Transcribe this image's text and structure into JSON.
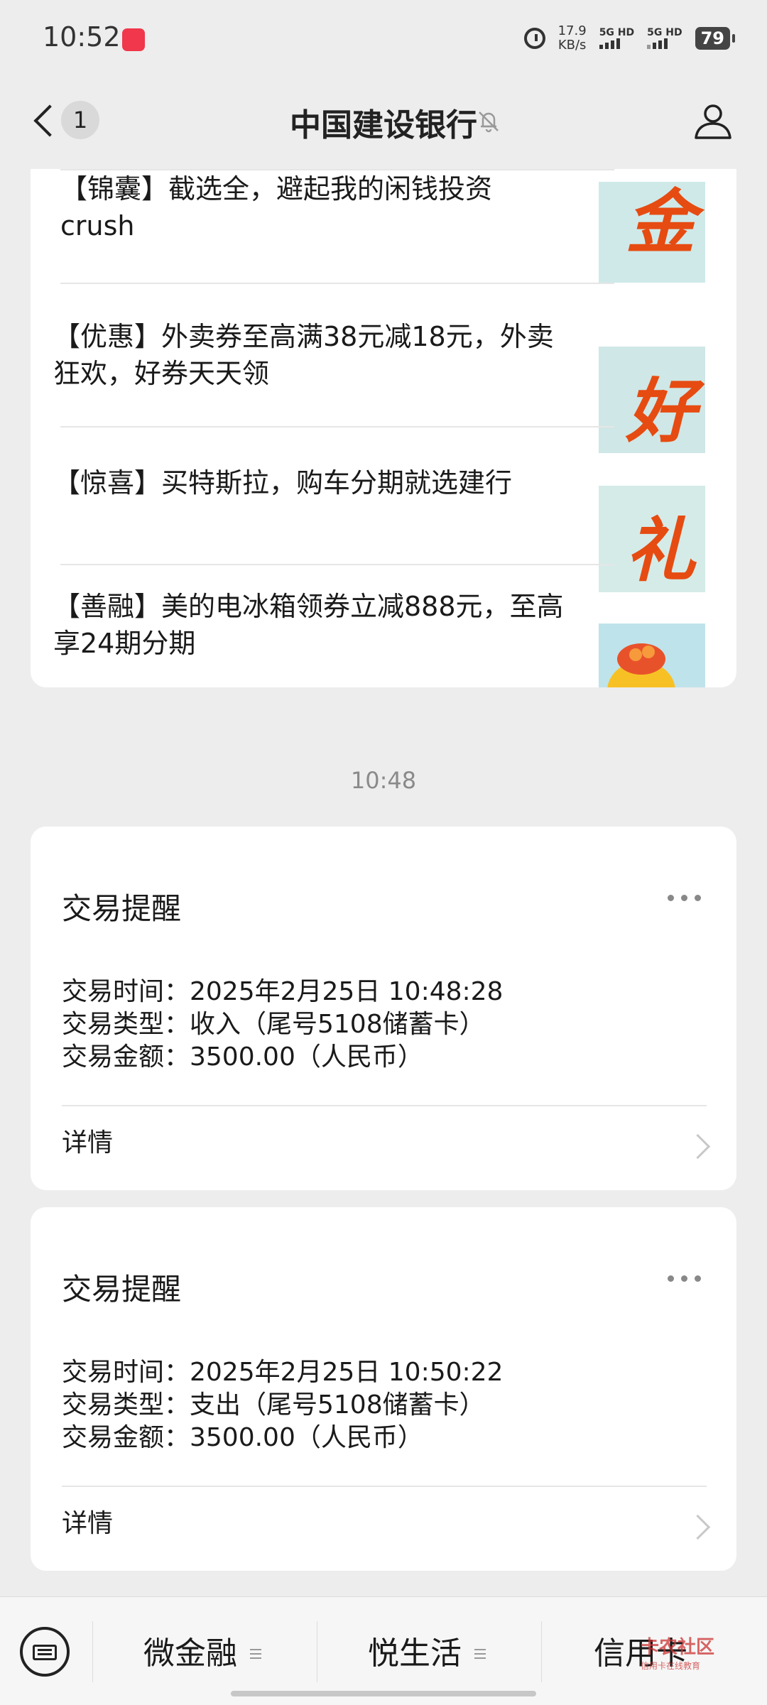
{
  "status_bar": {
    "time": "10:52",
    "net_speed_value": "17.9",
    "net_speed_unit": "KB/s",
    "sim1_label": "5G HD",
    "sim2_label": "5G HD",
    "battery": "79",
    "notification_color": "#f0374b"
  },
  "header": {
    "back_count": "1",
    "title": "中国建设银行",
    "icons": [
      "back-chevron-icon",
      "mute-bell-icon",
      "profile-icon"
    ]
  },
  "news": [
    {
      "text": "【锦囊】截选全，避起我的闲钱投资crush",
      "thumb_char": "金",
      "thumb_bg": "#cfe9e9"
    },
    {
      "text": "【优惠】外卖券至高满38元减18元，外卖狂欢，好券天天领",
      "thumb_char": "好",
      "thumb_bg": "#cfe7e6"
    },
    {
      "text": "【惊喜】买特斯拉，购车分期就选建行",
      "thumb_char": "礼",
      "thumb_bg": "#d5ebe8"
    },
    {
      "text": "【善融】美的电冰箱领券立减888元，至高享24期分期",
      "thumb_char": "",
      "thumb_bg": "#bfe3ea"
    }
  ],
  "timestamp": "10:48",
  "transactions": [
    {
      "title": "交易提醒",
      "time_line": "交易时间：2025年2月25日 10:48:28",
      "type_line": "交易类型：收入（尾号5108储蓄卡）",
      "amount_line": "交易金额：3500.00（人民币）",
      "detail_label": "详情"
    },
    {
      "title": "交易提醒",
      "time_line": "交易时间：2025年2月25日 10:50:22",
      "type_line": "交易类型：支出（尾号5108储蓄卡）",
      "amount_line": "交易金额：3500.00（人民币）",
      "detail_label": "详情"
    }
  ],
  "bottom_menu": {
    "items": [
      "微金融",
      "悦生活",
      "信用卡"
    ],
    "watermark": "卡农社区",
    "watermark_sub": "信用卡在线教育"
  },
  "colors": {
    "background": "#ededed",
    "card": "#ffffff",
    "accent_orange": "#e64b11"
  }
}
